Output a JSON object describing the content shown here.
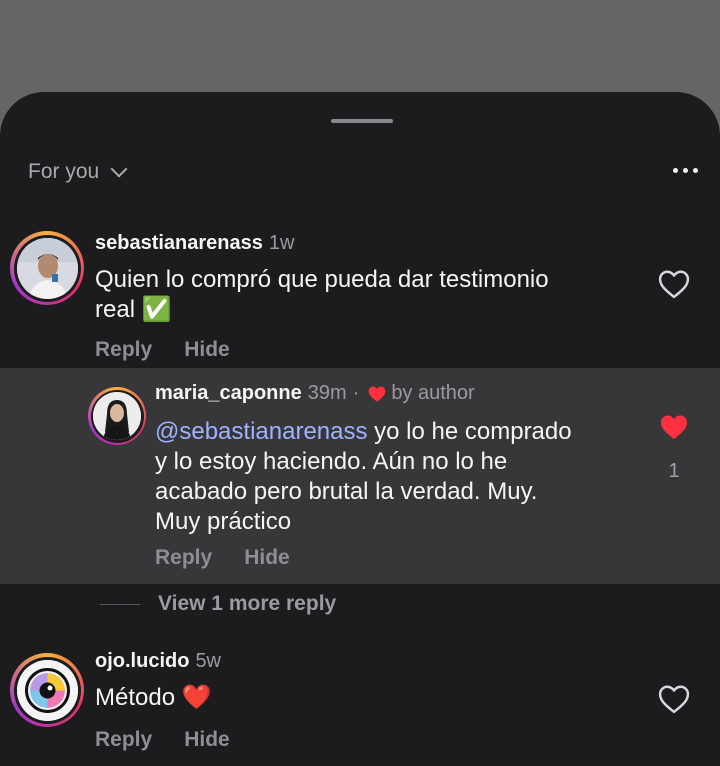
{
  "sheet": {
    "sort_label": "For you"
  },
  "comments": [
    {
      "username": "sebastianarenass",
      "time": "1w",
      "text_lines": [
        "Quien lo compró que pueda dar testimonio",
        "real ✅"
      ],
      "reply_label": "Reply",
      "hide_label": "Hide"
    },
    {
      "username": "maria_caponne",
      "time": "39m",
      "separator": "·",
      "badge": "by author",
      "mention": "@sebastianarenass",
      "text_first": " yo lo he comprado",
      "text_lines": [
        "y lo estoy haciendo. Aún no lo he",
        "acabado pero brutal la verdad. Muy.",
        "Muy práctico"
      ],
      "like_count": "1",
      "reply_label": "Reply",
      "hide_label": "Hide"
    },
    {
      "username": "ojo.lucido",
      "time": "5w",
      "text": "Método ❤️",
      "reply_label": "Reply",
      "hide_label": "Hide"
    }
  ],
  "view_more_replies": "View 1 more reply",
  "colors": {
    "sheet_bg": "#1c1c1e",
    "reply_bg": "#373739",
    "mention": "#9fb3ff",
    "liked_heart": "#ff3040"
  },
  "icons": {
    "sort": "chevron-down-icon",
    "options": "more-options-icon",
    "like": "heart-icon",
    "liked": "heart-filled-icon",
    "author_badge": "heart-filled-icon"
  }
}
